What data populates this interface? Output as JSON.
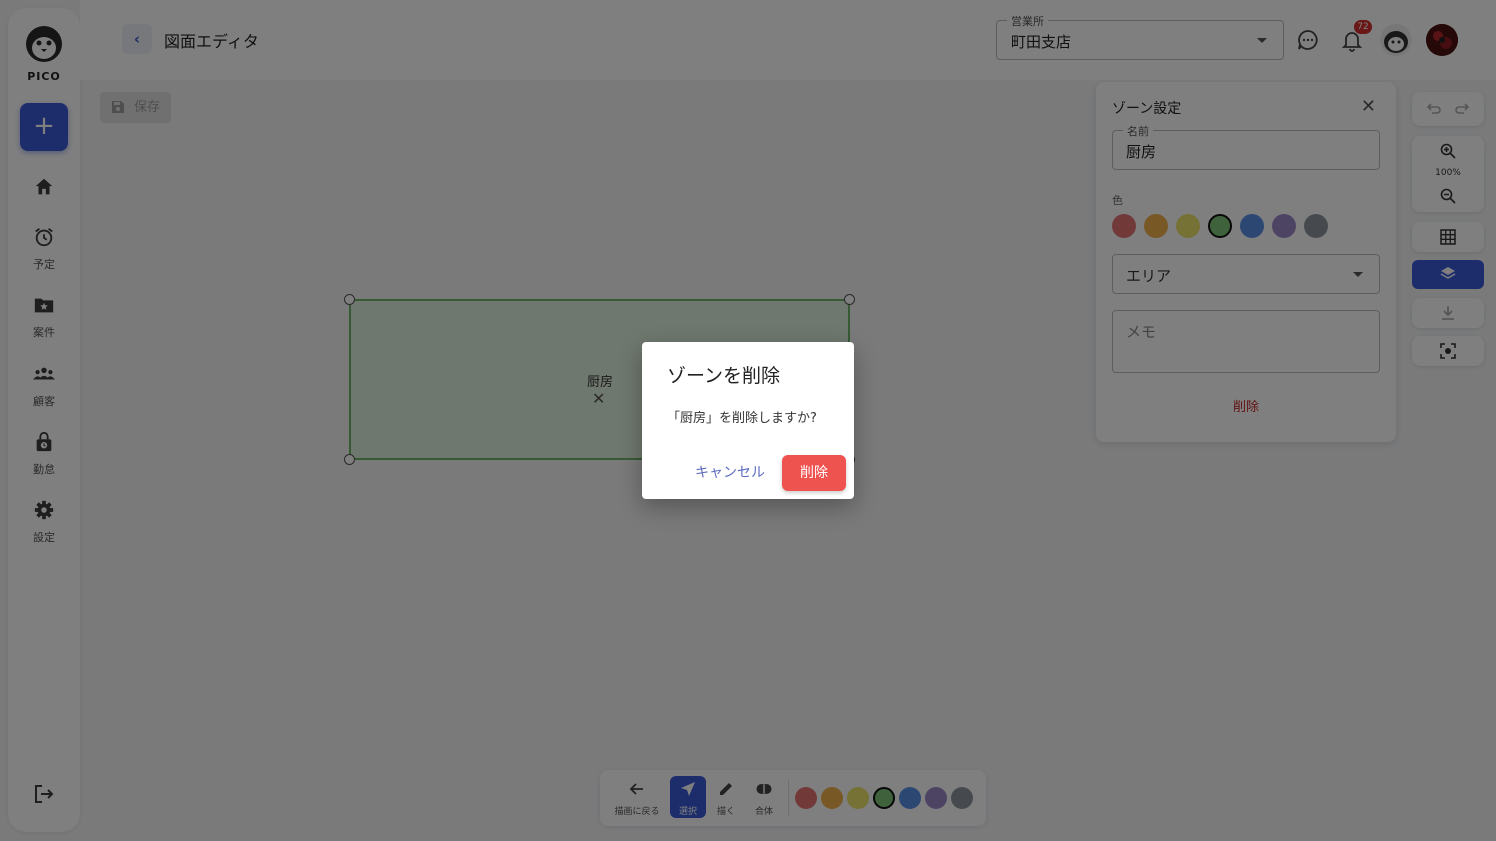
{
  "sidebar": {
    "logo_text": "PICO",
    "add_label": "+",
    "items": [
      {
        "label": "",
        "icon": "home-icon"
      },
      {
        "label": "予定",
        "icon": "alarm-clock-icon"
      },
      {
        "label": "案件",
        "icon": "folder-star-icon"
      },
      {
        "label": "顧客",
        "icon": "people-icon"
      },
      {
        "label": "勤怠",
        "icon": "lock-clock-icon"
      },
      {
        "label": "設定",
        "icon": "gear-icon"
      }
    ]
  },
  "header": {
    "back_label": "‹",
    "title": "図面エディタ",
    "office_label": "営業所",
    "office_value": "町田支店",
    "notification_count": "72"
  },
  "toolbar": {
    "save_label": "保存"
  },
  "canvas": {
    "zone_label": "厨房",
    "zone_remove": "✕"
  },
  "panel": {
    "title": "ゾーン設定",
    "close": "✕",
    "name_label": "名前",
    "name_value": "厨房",
    "color_label": "色",
    "colors": [
      "#e57373",
      "#f0b04a",
      "#ece26a",
      "#7fc47b",
      "#5b8fe6",
      "#9a88c7",
      "#8c959d"
    ],
    "selected_color_index": 3,
    "type_value": "エリア",
    "memo_placeholder": "メモ",
    "delete_label": "削除"
  },
  "tools": {
    "zoom_level": "100%"
  },
  "bottom_bar": {
    "back_label": "描画に戻る",
    "select_label": "選択",
    "draw_label": "描く",
    "merge_label": "合体",
    "colors": [
      "#e57373",
      "#f0b04a",
      "#ece26a",
      "#7fc47b",
      "#5b8fe6",
      "#9a88c7",
      "#8c959d"
    ],
    "selected_color_index": 3
  },
  "dialog": {
    "title": "ゾーンを削除",
    "message": "「厨房」を削除しますか?",
    "cancel_label": "キャンセル",
    "confirm_label": "削除"
  }
}
